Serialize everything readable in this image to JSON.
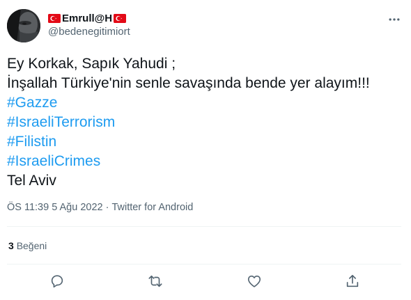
{
  "author": {
    "display_name": "Emrull@H",
    "handle": "@bedenegitimiort",
    "flag_emoji_name": "turkey-flag",
    "flag_color": "#e30a17"
  },
  "tweet": {
    "lines": [
      "Ey Korkak, Sapık Yahudi ;",
      "İnşallah Türkiye'nin senle savaşında bende yer alayım!!!"
    ],
    "hashtags": [
      "#Gazze",
      "#IsraeliTerrorism",
      "#Filistin",
      "#IsraeliCrimes"
    ],
    "location_line": "Tel Aviv"
  },
  "meta": {
    "time": "ÖS 11:39",
    "separator": "·",
    "date": "5 Ağu 2022",
    "source": "Twitter for Android"
  },
  "engagement": {
    "likes_count": "3",
    "likes_label": "Beğeni"
  },
  "colors": {
    "text_primary": "#0f1419",
    "text_secondary": "#536471",
    "link": "#1d9bf0",
    "divider": "#eff3f4",
    "icon": "#536471"
  },
  "icons": {
    "reply": "reply-icon",
    "retweet": "retweet-icon",
    "like": "like-icon",
    "share": "share-icon",
    "more": "more-icon"
  }
}
